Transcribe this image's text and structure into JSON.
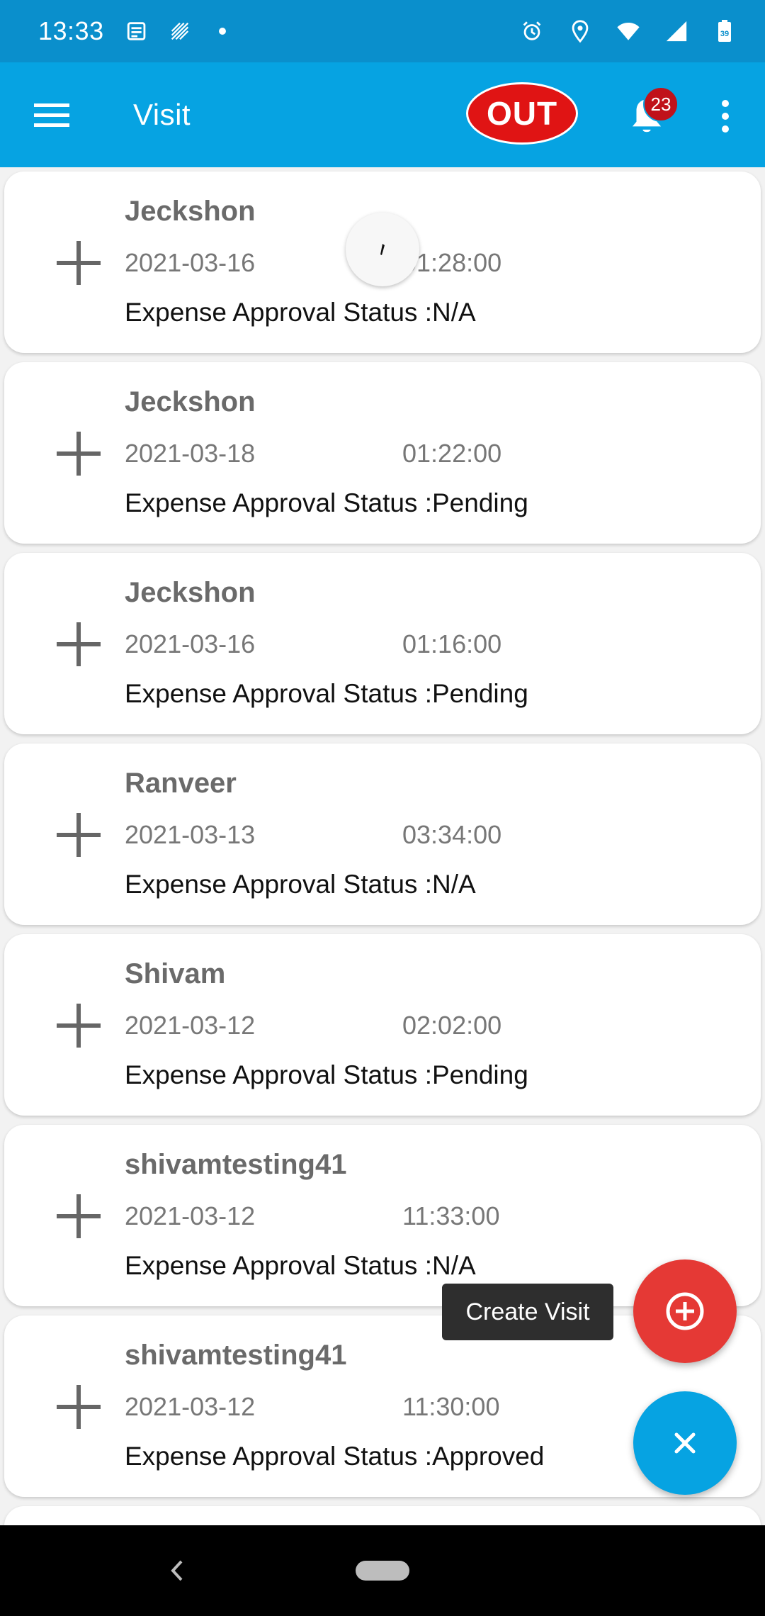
{
  "status_bar": {
    "time": "13:33",
    "battery": "39",
    "icons": [
      "news-icon",
      "cast-icon",
      "dot-icon",
      "alarm-icon",
      "location-icon",
      "wifi-icon",
      "signal-icon",
      "battery-icon"
    ]
  },
  "app_bar": {
    "title": "Visit",
    "out_label": "OUT",
    "notification_count": "23"
  },
  "visits": [
    {
      "name": "Jeckshon",
      "date": "2021-03-16",
      "time": "01:28:00",
      "status": "Expense Approval Status :N/A"
    },
    {
      "name": "Jeckshon",
      "date": "2021-03-18",
      "time": "01:22:00",
      "status": "Expense Approval Status :Pending"
    },
    {
      "name": "Jeckshon",
      "date": "2021-03-16",
      "time": "01:16:00",
      "status": "Expense Approval Status :Pending"
    },
    {
      "name": "Ranveer",
      "date": "2021-03-13",
      "time": "03:34:00",
      "status": "Expense Approval Status :N/A"
    },
    {
      "name": "Shivam",
      "date": "2021-03-12",
      "time": "02:02:00",
      "status": "Expense Approval Status :Pending"
    },
    {
      "name": "shivamtesting41",
      "date": "2021-03-12",
      "time": "11:33:00",
      "status": "Expense Approval Status :N/A"
    },
    {
      "name": "shivamtesting41",
      "date": "2021-03-12",
      "time": "11:30:00",
      "status": "Expense Approval Status :Approved"
    }
  ],
  "fab": {
    "create_label": "Create Visit"
  },
  "colors": {
    "status_bar": "#0a8fcc",
    "app_bar": "#06a3e2",
    "out_button": "#e01414",
    "badge": "#c0121a",
    "fab_create": "#e53935",
    "fab_close": "#06a3e2"
  }
}
